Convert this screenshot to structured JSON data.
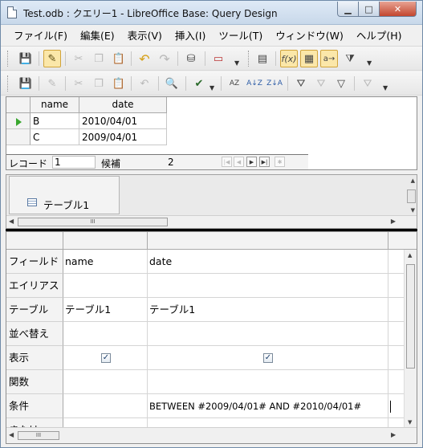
{
  "window": {
    "title": "Test.odb : クエリー1 - LibreOffice Base: Query Design"
  },
  "menu": [
    "ファイル(F)",
    "編集(E)",
    "表示(V)",
    "挿入(I)",
    "ツール(T)",
    "ウィンドウ(W)",
    "ヘルプ(H)"
  ],
  "toolbar1": {
    "icons": [
      "save-icon",
      "edit-mode-icon",
      "cut-icon",
      "copy-icon",
      "paste-icon",
      "undo-icon",
      "redo-icon",
      "run-query-icon",
      "clear-query-icon",
      "add-table-icon",
      "functions-icon",
      "table-name-icon",
      "alias-icon",
      "distinct-values-icon"
    ]
  },
  "toolbar2": {
    "icons": [
      "save-record-icon",
      "edit-data-icon",
      "cut-icon",
      "copy-icon",
      "paste-icon",
      "undo-record-icon",
      "find-record-icon",
      "spellcheck-icon",
      "sort-icon",
      "sort-ascending-icon",
      "sort-descending-icon",
      "autofilter-icon",
      "standard-filter-icon",
      "apply-filter-icon",
      "remove-filter-icon"
    ]
  },
  "result": {
    "columns": [
      "name",
      "date"
    ],
    "rows": [
      [
        "B",
        "2010/04/01"
      ],
      [
        "C",
        "2009/04/01"
      ]
    ],
    "navigator": {
      "record_label": "レコード",
      "record_value": "1",
      "candidates_label": "候補",
      "candidates_value": "2"
    }
  },
  "table_window": {
    "name": "テーブル1"
  },
  "design": {
    "row_labels": [
      "フィールド",
      "エイリアス",
      "テーブル",
      "並べ替え",
      "表示",
      "関数",
      "条件",
      "または"
    ],
    "columns": [
      {
        "field": "name",
        "alias": "",
        "table": "テーブル1",
        "sort": "",
        "visible": true,
        "function": "",
        "criterion": ""
      },
      {
        "field": "date",
        "alias": "",
        "table": "テーブル1",
        "sort": "",
        "visible": true,
        "function": "",
        "criterion": "BETWEEN #2009/04/01# AND #2010/04/01#"
      }
    ]
  },
  "scroll_glyph": "III",
  "colors": {
    "accent_arrow": "#39a72f",
    "close_button": "#c3462e"
  }
}
